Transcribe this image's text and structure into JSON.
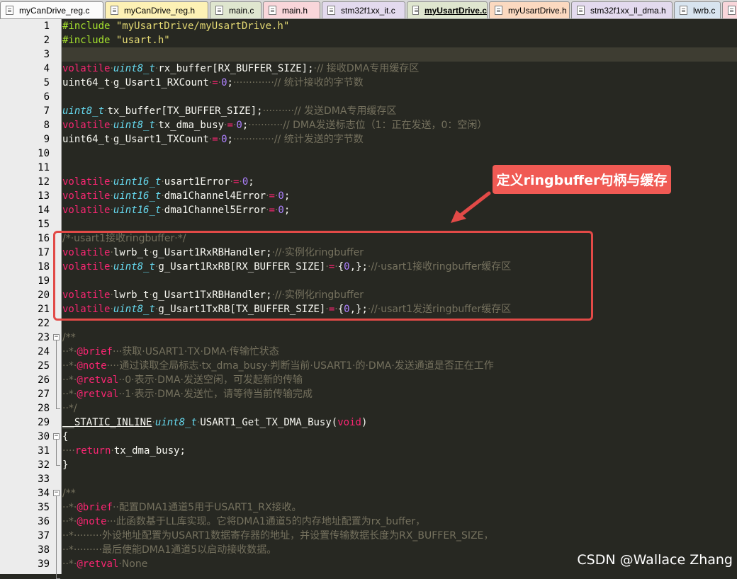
{
  "tabs": [
    {
      "label": "myCanDrive_reg.c",
      "color": "#fbfbfb",
      "width": 146,
      "active": false
    },
    {
      "label": "myCanDrive_reg.h",
      "color": "#fdf1b5",
      "width": 146,
      "active": false
    },
    {
      "label": "main.c",
      "color": "#dfe6cf",
      "width": 73,
      "active": false
    },
    {
      "label": "main.h",
      "color": "#f9d6da",
      "width": 81,
      "active": false
    },
    {
      "label": "stm32f1xx_it.c",
      "color": "#e3daee",
      "width": 118,
      "active": false
    },
    {
      "label": "myUsartDrive.c",
      "color": "#dfe6cf",
      "width": 114,
      "active": true
    },
    {
      "label": "myUsartDrive.h",
      "color": "#fbd9c0",
      "width": 114,
      "active": false
    },
    {
      "label": "stm32f1xx_ll_dma.h",
      "color": "#e3daee",
      "width": 143,
      "active": false
    },
    {
      "label": "lwrb.c",
      "color": "#d8e4ef",
      "width": 66,
      "active": false
    },
    {
      "label": "",
      "color": "#f9d6da",
      "width": 30,
      "active": false
    }
  ],
  "colors": {
    "editor_bg": "#272822",
    "accent_red": "#e24a47",
    "callout_fill": "#f05a54"
  },
  "current_line": 3,
  "lines": [
    {
      "n": 1,
      "p": [
        [
          "d",
          "#include "
        ],
        [
          "s",
          "\"myUsartDrive/myUsartDrive.h\""
        ]
      ]
    },
    {
      "n": 2,
      "p": [
        [
          "d",
          "#include "
        ],
        [
          "s",
          "\"usart.h\""
        ]
      ]
    },
    {
      "n": 3,
      "p": []
    },
    {
      "n": 4,
      "p": [
        [
          "k",
          "volatile"
        ],
        [
          "c",
          "·"
        ],
        [
          "t",
          "uint8_t"
        ],
        [
          "c",
          "·"
        ],
        [
          "w",
          "rx_buffer[RX_BUFFER_SIZE];"
        ],
        [
          "c",
          "·// 接收DMA专用缓存区"
        ]
      ]
    },
    {
      "n": 5,
      "p": [
        [
          "w",
          "uint64_t"
        ],
        [
          "c",
          "·"
        ],
        [
          "w",
          "g_Usart1_RXCount"
        ],
        [
          "c",
          "·"
        ],
        [
          "k",
          "="
        ],
        [
          "c",
          "·"
        ],
        [
          "n",
          "0"
        ],
        [
          "w",
          ";"
        ],
        [
          "c",
          "·············// 统计接收的字节数"
        ]
      ]
    },
    {
      "n": 6,
      "p": []
    },
    {
      "n": 7,
      "p": [
        [
          "t",
          "uint8_t"
        ],
        [
          "c",
          "·"
        ],
        [
          "w",
          "tx_buffer[TX_BUFFER_SIZE];"
        ],
        [
          "c",
          "··········// 发送DMA专用缓存区"
        ]
      ]
    },
    {
      "n": 8,
      "p": [
        [
          "k",
          "volatile"
        ],
        [
          "c",
          "·"
        ],
        [
          "t",
          "uint8_t"
        ],
        [
          "c",
          "·"
        ],
        [
          "w",
          "tx_dma_busy"
        ],
        [
          "c",
          "·"
        ],
        [
          "k",
          "="
        ],
        [
          "c",
          "·"
        ],
        [
          "n",
          "0"
        ],
        [
          "w",
          ";"
        ],
        [
          "c",
          "···········// DMA发送标志位（1：正在发送，0：空闲）"
        ]
      ]
    },
    {
      "n": 9,
      "p": [
        [
          "w",
          "uint64_t"
        ],
        [
          "c",
          "·"
        ],
        [
          "w",
          "g_Usart1_TXCount"
        ],
        [
          "c",
          "·"
        ],
        [
          "k",
          "="
        ],
        [
          "c",
          "·"
        ],
        [
          "n",
          "0"
        ],
        [
          "w",
          ";"
        ],
        [
          "c",
          "·············// 统计发送的字节数"
        ]
      ]
    },
    {
      "n": 10,
      "p": []
    },
    {
      "n": 11,
      "p": []
    },
    {
      "n": 12,
      "p": [
        [
          "k",
          "volatile"
        ],
        [
          "c",
          "·"
        ],
        [
          "t",
          "uint16_t"
        ],
        [
          "c",
          "·"
        ],
        [
          "w",
          "usart1Error"
        ],
        [
          "c",
          "·"
        ],
        [
          "k",
          "="
        ],
        [
          "c",
          "·"
        ],
        [
          "n",
          "0"
        ],
        [
          "w",
          ";"
        ]
      ]
    },
    {
      "n": 13,
      "p": [
        [
          "k",
          "volatile"
        ],
        [
          "c",
          "·"
        ],
        [
          "t",
          "uint16_t"
        ],
        [
          "c",
          "·"
        ],
        [
          "w",
          "dma1Channel4Error"
        ],
        [
          "c",
          "·"
        ],
        [
          "k",
          "="
        ],
        [
          "c",
          "·"
        ],
        [
          "n",
          "0"
        ],
        [
          "w",
          ";"
        ]
      ]
    },
    {
      "n": 14,
      "p": [
        [
          "k",
          "volatile"
        ],
        [
          "c",
          "·"
        ],
        [
          "t",
          "uint16_t"
        ],
        [
          "c",
          "·"
        ],
        [
          "w",
          "dma1Channel5Error"
        ],
        [
          "c",
          "·"
        ],
        [
          "k",
          "="
        ],
        [
          "c",
          "·"
        ],
        [
          "n",
          "0"
        ],
        [
          "w",
          ";"
        ]
      ]
    },
    {
      "n": 15,
      "p": []
    },
    {
      "n": 16,
      "p": [
        [
          "c",
          "/*·usart1接收ringbuffer·*/"
        ]
      ]
    },
    {
      "n": 17,
      "p": [
        [
          "k",
          "volatile"
        ],
        [
          "c",
          "·"
        ],
        [
          "w",
          "lwrb_t"
        ],
        [
          "c",
          "·"
        ],
        [
          "w",
          "g_Usart1RxRBHandler;"
        ],
        [
          "c",
          "·//·实例化ringbuffer"
        ]
      ]
    },
    {
      "n": 18,
      "p": [
        [
          "k",
          "volatile"
        ],
        [
          "c",
          "·"
        ],
        [
          "t",
          "uint8_t"
        ],
        [
          "c",
          "·"
        ],
        [
          "w",
          "g_Usart1RxRB[RX_BUFFER_SIZE]"
        ],
        [
          "c",
          "·"
        ],
        [
          "k",
          "="
        ],
        [
          "c",
          "·"
        ],
        [
          "w",
          "{"
        ],
        [
          "n",
          "0"
        ],
        [
          "w",
          ",};"
        ],
        [
          "c",
          "·//·usart1接收ringbuffer缓存区"
        ]
      ]
    },
    {
      "n": 19,
      "p": []
    },
    {
      "n": 20,
      "p": [
        [
          "k",
          "volatile"
        ],
        [
          "c",
          "·"
        ],
        [
          "w",
          "lwrb_t"
        ],
        [
          "c",
          "·"
        ],
        [
          "w",
          "g_Usart1TxRBHandler;"
        ],
        [
          "c",
          "·//·实例化ringbuffer"
        ]
      ]
    },
    {
      "n": 21,
      "p": [
        [
          "k",
          "volatile"
        ],
        [
          "c",
          "·"
        ],
        [
          "t",
          "uint8_t"
        ],
        [
          "c",
          "·"
        ],
        [
          "w",
          "g_Usart1TxRB[TX_BUFFER_SIZE]"
        ],
        [
          "c",
          "·"
        ],
        [
          "k",
          "="
        ],
        [
          "c",
          "·"
        ],
        [
          "w",
          "{"
        ],
        [
          "n",
          "0"
        ],
        [
          "w",
          ",};"
        ],
        [
          "c",
          "·//·usart1发送ringbuffer缓存区"
        ]
      ]
    },
    {
      "n": 22,
      "p": []
    },
    {
      "n": 23,
      "p": [
        [
          "c",
          "/**"
        ]
      ]
    },
    {
      "n": 24,
      "p": [
        [
          "c",
          "··*·"
        ],
        [
          "k",
          "@brief"
        ],
        [
          "c",
          "···获取·USART1·TX·DMA·传输忙状态"
        ]
      ]
    },
    {
      "n": 25,
      "p": [
        [
          "c",
          "··*·"
        ],
        [
          "k",
          "@note"
        ],
        [
          "c",
          "····通过读取全局标志·tx_dma_busy·判断当前·USART1·的·DMA·发送通道是否正在工作"
        ]
      ]
    },
    {
      "n": 26,
      "p": [
        [
          "c",
          "··*·"
        ],
        [
          "k",
          "@retval"
        ],
        [
          "c",
          "··0·表示·DMA·发送空闲，可发起新的传输"
        ]
      ]
    },
    {
      "n": 27,
      "p": [
        [
          "c",
          "··*·"
        ],
        [
          "k",
          "@retval"
        ],
        [
          "c",
          "··1·表示·DMA·发送忙，请等待当前传输完成"
        ]
      ]
    },
    {
      "n": 28,
      "p": [
        [
          "c",
          "··*/"
        ]
      ]
    },
    {
      "n": 29,
      "p": [
        [
          "wu",
          "__STATIC_INLINE"
        ],
        [
          "c",
          "·"
        ],
        [
          "t",
          "uint8_t"
        ],
        [
          "c",
          "·"
        ],
        [
          "w",
          "USART1_Get_TX_DMA_Busy("
        ],
        [
          "k",
          "void"
        ],
        [
          "w",
          ")"
        ]
      ]
    },
    {
      "n": 30,
      "p": [
        [
          "w",
          "{"
        ]
      ]
    },
    {
      "n": 31,
      "p": [
        [
          "c",
          "····"
        ],
        [
          "k",
          "return"
        ],
        [
          "c",
          "·"
        ],
        [
          "w",
          "tx_dma_busy;"
        ]
      ]
    },
    {
      "n": 32,
      "p": [
        [
          "w",
          "}"
        ]
      ]
    },
    {
      "n": 33,
      "p": []
    },
    {
      "n": 34,
      "p": [
        [
          "c",
          "/**"
        ]
      ]
    },
    {
      "n": 35,
      "p": [
        [
          "c",
          "··*·"
        ],
        [
          "k",
          "@brief"
        ],
        [
          "c",
          "··配置DMA1通道5用于USART1_RX接收。"
        ]
      ]
    },
    {
      "n": 36,
      "p": [
        [
          "c",
          "··*·"
        ],
        [
          "k",
          "@note"
        ],
        [
          "c",
          "···此函数基于LL库实现。它将DMA1通道5的内存地址配置为rx_buffer，"
        ]
      ]
    },
    {
      "n": 37,
      "p": [
        [
          "c",
          "··*·········外设地址配置为USART1数据寄存器的地址，并设置传输数据长度为RX_BUFFER_SIZE，"
        ]
      ]
    },
    {
      "n": 38,
      "p": [
        [
          "c",
          "··*·········最后使能DMA1通道5以启动接收数据。"
        ]
      ]
    },
    {
      "n": 39,
      "p": [
        [
          "c",
          "··*·"
        ],
        [
          "k",
          "@retval"
        ],
        [
          "c",
          "·None"
        ]
      ]
    }
  ],
  "annotation": {
    "label": "定义ringbuffer句柄与缓存"
  },
  "watermark": "CSDN @Wallace Zhang"
}
